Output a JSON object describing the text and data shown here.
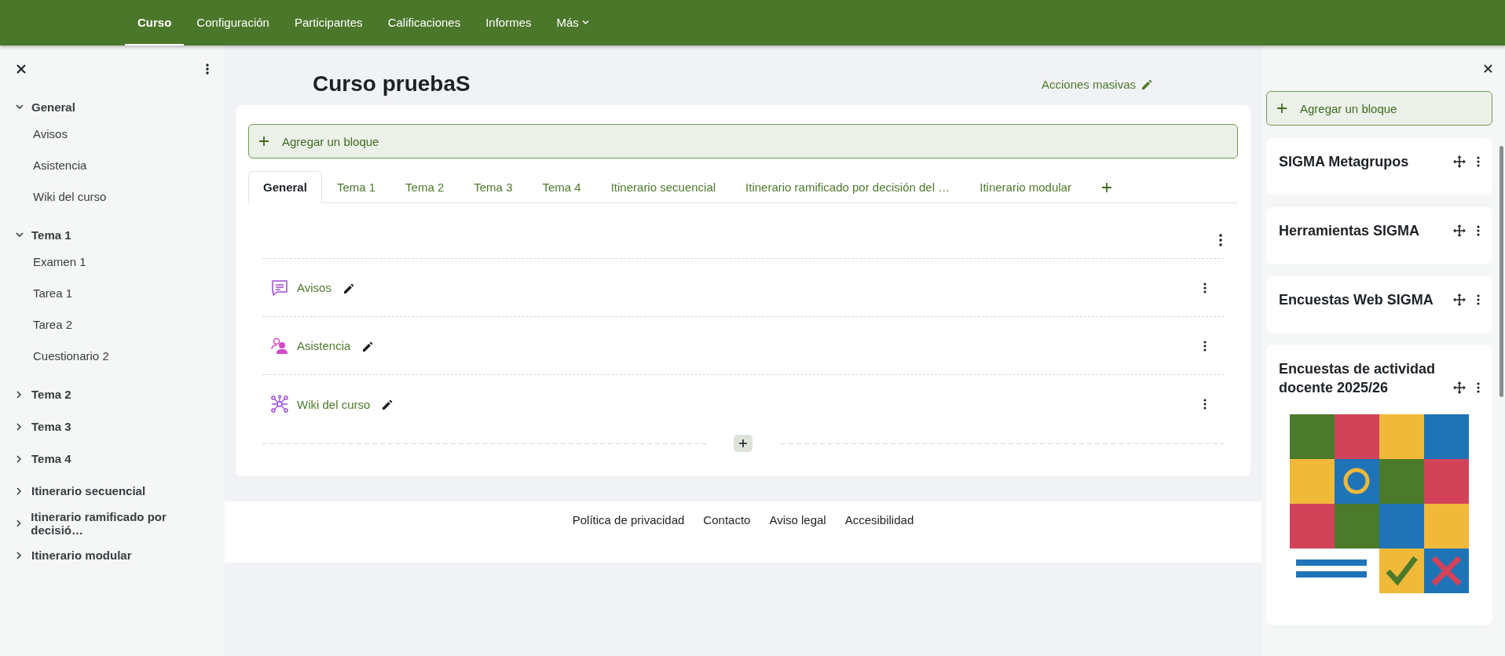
{
  "nav": [
    {
      "label": "Curso",
      "selected": true
    },
    {
      "label": "Configuración",
      "selected": false
    },
    {
      "label": "Participantes",
      "selected": false
    },
    {
      "label": "Calificaciones",
      "selected": false
    },
    {
      "label": "Informes",
      "selected": false
    },
    {
      "label": "Más",
      "selected": false,
      "kind": "dropdown"
    }
  ],
  "course_index": {
    "sections": [
      {
        "title": "General",
        "expanded": true,
        "children": [
          {
            "label": "Avisos"
          },
          {
            "label": "Asistencia"
          },
          {
            "label": "Wiki del curso"
          }
        ]
      },
      {
        "title": "Tema 1",
        "expanded": true,
        "children": [
          {
            "label": "Examen 1"
          },
          {
            "label": "Tarea 1"
          },
          {
            "label": "Tarea 2"
          },
          {
            "label": "Cuestionario 2"
          }
        ]
      },
      {
        "title": "Tema 2",
        "expanded": false
      },
      {
        "title": "Tema 3",
        "expanded": false
      },
      {
        "title": "Tema 4",
        "expanded": false
      },
      {
        "title": "Itinerario secuencial",
        "expanded": false
      },
      {
        "title": "Itinerario ramificado por decisió…",
        "expanded": false
      },
      {
        "title": "Itinerario modular",
        "expanded": false
      }
    ]
  },
  "page_title": "Curso pruebaS",
  "bulk_actions": "Acciones masivas",
  "add_block": "Agregar un bloque",
  "tabs": [
    {
      "label": "General",
      "selected": true
    },
    {
      "label": "Tema 1",
      "selected": false
    },
    {
      "label": "Tema 2",
      "selected": false
    },
    {
      "label": "Tema 3",
      "selected": false
    },
    {
      "label": "Tema 4",
      "selected": false
    },
    {
      "label": "Itinerario secuencial",
      "selected": false
    },
    {
      "label": "Itinerario ramificado por decisión del …",
      "selected": false
    },
    {
      "label": "Itinerario modular",
      "selected": false
    }
  ],
  "activities": [
    {
      "name": "Avisos",
      "kind": "forum"
    },
    {
      "name": "Asistencia",
      "kind": "attendance"
    },
    {
      "name": "Wiki del curso",
      "kind": "wiki"
    }
  ],
  "footer": [
    "Política de privacidad",
    "Contacto",
    "Aviso legal",
    "Accesibilidad"
  ],
  "block_drawer": {
    "add_block": "Agregar un bloque",
    "blocks": [
      {
        "title": "SIGMA Metagrupos"
      },
      {
        "title": "Herramientas SIGMA"
      },
      {
        "title": "Encuestas Web SIGMA"
      },
      {
        "title": "Encuestas de actividad docente 2025/26",
        "kind": "picture"
      }
    ]
  }
}
